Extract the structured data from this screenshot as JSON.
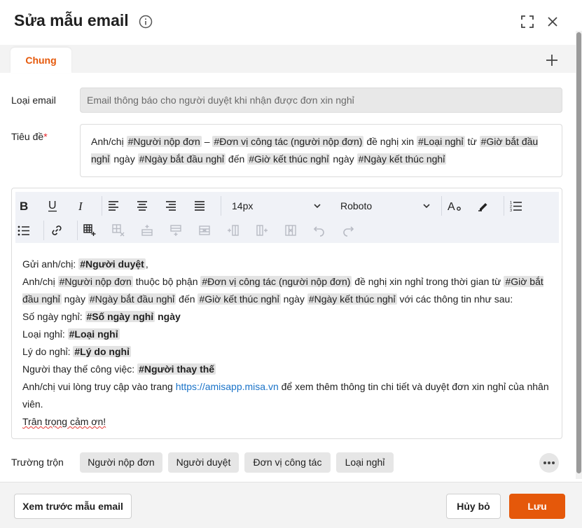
{
  "dialog": {
    "title": "Sửa mẫu email",
    "accent_color": "#e5580a"
  },
  "tabs": [
    {
      "label": "Chung",
      "active": true
    }
  ],
  "form": {
    "email_type_label": "Loại email",
    "email_type_value": "Email thông báo cho người duyệt khi nhận được đơn xin nghỉ",
    "subject_label": "Tiêu đề",
    "subject_required": "*",
    "subject": {
      "t1": "Anh/chị ",
      "tag1": "#Người nộp đơn",
      "t2": " – ",
      "tag2": "#Đơn vị công tác (người nộp đơn)",
      "t3": " đề nghị xin ",
      "tag3": "#Loại nghỉ",
      "t4": " từ ",
      "tag4": "#Giờ bắt đầu nghỉ",
      "t5": " ngày ",
      "tag5": "#Ngày bắt đầu nghỉ",
      "t6": " đến ",
      "tag6": "#Giờ kết thúc nghỉ",
      "t7": " ngày ",
      "tag7": "#Ngày kết thúc nghỉ"
    }
  },
  "toolbar": {
    "font_size": "14px",
    "font_family": "Roboto",
    "icons": [
      "bold-icon",
      "underline-icon",
      "italic-icon",
      "align-left-icon",
      "align-center-icon",
      "align-right-icon",
      "align-justify-icon",
      "font-size-icon",
      "highlight-icon",
      "ordered-list-icon",
      "unordered-list-icon",
      "link-icon",
      "insert-table-icon",
      "delete-table-icon",
      "insert-row-above-icon",
      "insert-row-below-icon",
      "delete-row-icon",
      "insert-column-left-icon",
      "insert-column-right-icon",
      "delete-column-icon",
      "undo-icon",
      "redo-icon"
    ]
  },
  "body": {
    "l1_a": "Gửi anh/chị: ",
    "l1_tag": "#Người duyệt",
    "l1_b": ",",
    "l2_a": "Anh/chị ",
    "l2_tag1": "#Người nộp đơn",
    "l2_b": " thuộc bộ phận ",
    "l2_tag2": "#Đơn vị công tác (người nộp đơn)",
    "l2_c": " đề nghị xin nghỉ trong thời gian từ ",
    "l2_tag3": "#Giờ bắt đầu nghỉ",
    "l2_d": " ngày ",
    "l2_tag4": "#Ngày bắt đầu nghỉ",
    "l2_e": " đến ",
    "l2_tag5": "#Giờ kết thúc nghỉ",
    "l2_f": " ngày ",
    "l2_tag6": "#Ngày kết thúc nghỉ",
    "l2_g": " với các thông tin như sau:",
    "l3_a": " Số ngày nghỉ: ",
    "l3_tag": "#Số ngày nghỉ",
    "l3_b": " ngày",
    "l4_a": " Loại nghỉ: ",
    "l4_tag": "#Loại nghỉ",
    "l5_a": " Lý do nghỉ: ",
    "l5_tag": "#Lý do nghỉ",
    "l6_a": " Người thay thế công việc: ",
    "l6_tag": "#Người thay thế",
    "l7_a": " Anh/chị vui lòng truy cập vào trang ",
    "l7_link": "https://amisapp.misa.vn",
    "l7_b": " để xem thêm thông tin chi tiết và duyệt đơn xin nghỉ của nhân viên.",
    "l8": " Trân trọng cảm ơn!"
  },
  "merge_fields": {
    "label": "Trường trộn",
    "chips": [
      "Người nộp đơn",
      "Người duyệt",
      "Đơn vị công tác",
      "Loại nghỉ"
    ]
  },
  "footer": {
    "preview_label": "Xem trước mẫu email",
    "cancel_label": "Hủy bỏ",
    "save_label": "Lưu"
  }
}
